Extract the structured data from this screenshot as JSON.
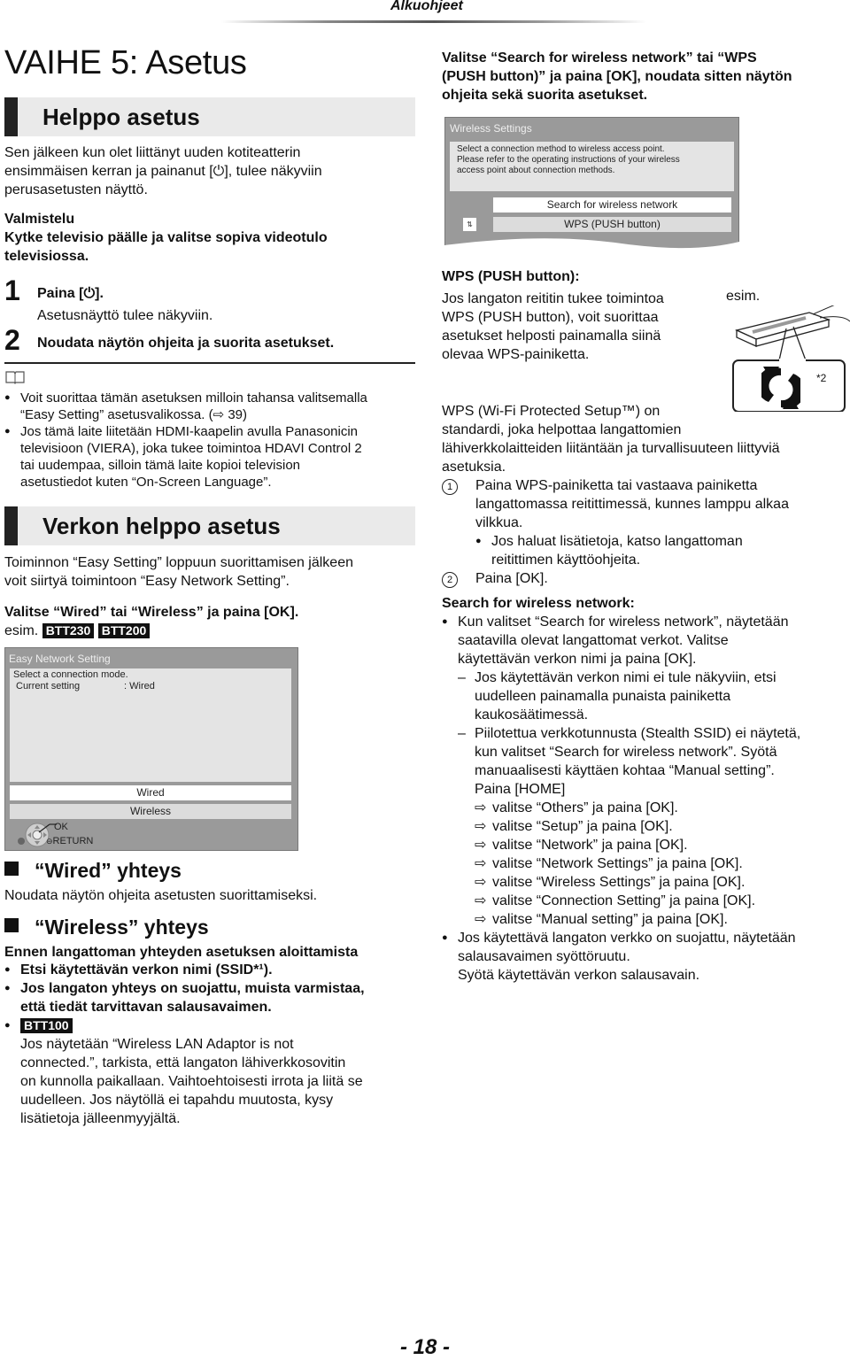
{
  "header": {
    "section": "Alkuohjeet"
  },
  "title": "VAIHE 5: Asetus",
  "easy_setting": {
    "heading": "Helppo asetus",
    "intro": [
      "Sen jälkeen kun olet liittänyt uuden kotiteatterin",
      "ensimmäisen kerran ja painanut [⏻], tulee näkyviin",
      "perusasetusten näyttö."
    ],
    "prep_label": "Valmistelu",
    "prep_text": [
      "Kytke televisio päälle ja valitse sopiva videotulo",
      "televisiossa."
    ],
    "steps": [
      {
        "num": "1",
        "text": "Paina [⏻].",
        "sub": "Asetusnäyttö tulee näkyviin."
      },
      {
        "num": "2",
        "text": "Noudata näytön ohjeita ja suorita asetukset."
      }
    ],
    "notes": [
      [
        "Voit suorittaa tämän asetuksen milloin tahansa valitsemalla",
        "“Easy Setting” asetusvalikossa. (⇨ 39)"
      ],
      [
        "Jos tämä laite liitetään HDMI-kaapelin avulla Panasonicin",
        "televisioon (VIERA), joka tukee toimintoa HDAVI Control 2",
        "tai uudempaa, silloin tämä laite kopioi television",
        "asetustiedot kuten “On-Screen Language”."
      ]
    ]
  },
  "network_setting": {
    "heading": "Verkon helppo asetus",
    "intro": [
      "Toiminnon “Easy Setting” loppuun suorittamisen jälkeen",
      "voit siirtyä toimintoon “Easy Network Setting”."
    ],
    "instruction": "Valitse “Wired” tai “Wireless” ja paina [OK].",
    "example_label": "esim.",
    "models": [
      "BTT230",
      "BTT200"
    ],
    "dialog": {
      "title": "Easy Network Setting",
      "line1": "Select a connection mode.",
      "current_label": "Current setting",
      "current_value": ":  Wired",
      "options": [
        "Wired",
        "Wireless"
      ],
      "selected": "Wired",
      "ok": "OK",
      "return": "RETURN"
    },
    "wired": {
      "heading": "“Wired” yhteys",
      "text": "Noudata näytön ohjeita asetusten suorittamiseksi."
    },
    "wireless": {
      "heading": "“Wireless” yhteys",
      "before": "Ennen langattoman yhteyden asetuksen aloittamista",
      "bullets": [
        [
          "Etsi käytettävän verkon nimi (SSID*¹)."
        ],
        [
          "Jos langaton yhteys on suojattu, muista varmistaa,",
          "että tiedät tarvittavan salausavaimen."
        ]
      ],
      "btt100_tag": "BTT100",
      "btt100_text": [
        "Jos näytetään “Wireless LAN Adaptor is not",
        "connected.”, tarkista, että langaton lähiverkkosovitin",
        "on kunnolla paikallaan. Vaihtoehtoisesti irrota ja liitä se",
        "uudelleen. Jos näytöllä ei tapahdu muutosta, kysy",
        "lisätietoja jälleenmyyjältä."
      ]
    }
  },
  "right": {
    "instruction": [
      "Valitse “Search for wireless network” tai “WPS",
      "(PUSH button)” ja paina [OK], noudata sitten näytön",
      "ohjeita sekä suorita asetukset."
    ],
    "dialog": {
      "title": "Wireless Settings",
      "text": [
        "Select a connection method to wireless access point.",
        "Please refer to the operating instructions of your wireless",
        "access point about connection methods."
      ],
      "options": [
        "Search for wireless network",
        "WPS (PUSH button)"
      ],
      "selected": "Search for wireless network"
    },
    "wps_heading": "WPS (PUSH button):",
    "wps_text": [
      "Jos langaton reititin tukee toimintoa",
      "WPS (PUSH button), voit suorittaa",
      "asetukset helposti painamalla siinä",
      "olevaa WPS-painiketta."
    ],
    "example_label": "esim.",
    "footnote_mark": "*2",
    "wps_desc": [
      "WPS (Wi-Fi Protected Setup™) on",
      "standardi, joka helpottaa langattomien",
      "lähiverkkolaitteiden liitäntään ja turvallisuuteen liittyviä",
      "asetuksia."
    ],
    "wps_steps": [
      {
        "num": "1",
        "lines": [
          "Paina WPS-painiketta tai vastaava painiketta",
          "langattomassa reitittimessä, kunnes lamppu alkaa",
          "vilkkua."
        ],
        "sub": [
          "Jos haluat lisätietoja, katso langattoman",
          "reitittimen käyttöohjeita."
        ]
      },
      {
        "num": "2",
        "lines": [
          "Paina [OK]."
        ]
      }
    ],
    "search_heading": "Search for wireless network:",
    "search_bullet": [
      "Kun valitset “Search for wireless network”, näytetään",
      "saatavilla olevat langattomat verkot. Valitse",
      "käytettävän verkon nimi ja paina [OK]."
    ],
    "dash1": [
      "Jos käytettävän verkon nimi ei tule näkyviin, etsi",
      "uudelleen painamalla punaista painiketta",
      "kaukosäätimessä."
    ],
    "dash2": [
      "Piilotettua verkkotunnusta (Stealth SSID) ei näytetä,",
      "kun valitset “Search for wireless network”. Syötä",
      "manuaalisesti käyttäen kohtaa “Manual setting”.",
      "Paina [HOME]"
    ],
    "menu_steps": [
      "valitse “Others” ja paina [OK].",
      "valitse “Setup” ja paina [OK].",
      "valitse “Network” ja paina [OK].",
      "valitse “Network Settings” ja paina [OK].",
      "valitse “Wireless Settings” ja paina [OK].",
      "valitse “Connection Setting” ja paina [OK].",
      "valitse “Manual setting” ja paina [OK]."
    ],
    "secure_bullet": [
      "Jos käytettävä langaton verkko on suojattu, näytetään",
      "salausavaimen syöttöruutu."
    ],
    "secure_last": "Syötä käytettävän verkon salausavain."
  },
  "page_number": "- 18 -"
}
